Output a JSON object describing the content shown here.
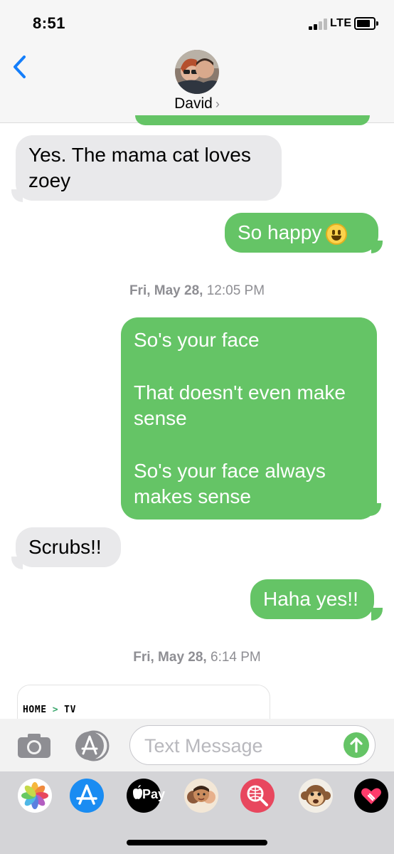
{
  "status_bar": {
    "time": "8:51",
    "network": "LTE"
  },
  "header": {
    "contact_name": "David",
    "chevron": "›"
  },
  "messages": [
    {
      "id": 1,
      "direction": "incoming",
      "text": "Yes. The mama cat loves zoey"
    },
    {
      "id": 2,
      "direction": "outgoing",
      "text": "So happy",
      "emoji": "grinning-face"
    },
    {
      "id": 3,
      "direction": "outgoing",
      "paragraphs": [
        "So's your face",
        "That doesn't even make sense",
        "So's your face always makes sense"
      ]
    },
    {
      "id": 4,
      "direction": "incoming",
      "text": "Scrubs!!"
    },
    {
      "id": 5,
      "direction": "outgoing",
      "text": "Haha yes!!"
    }
  ],
  "timestamps": [
    {
      "day": "Fri, May 28,",
      "time": " 12:05 PM"
    },
    {
      "day": "Fri, May 28,",
      "time": " 6:14 PM"
    }
  ],
  "link_preview": {
    "crumb_home": "HOME",
    "crumb_sep": ">",
    "crumb_section": "TV"
  },
  "composer": {
    "placeholder": "Text Message",
    "value": ""
  },
  "app_drawer": [
    {
      "name": "photos-app-icon"
    },
    {
      "name": "app-store-icon"
    },
    {
      "name": "apple-pay-icon",
      "label": "Pay"
    },
    {
      "name": "memoji-stickers-icon"
    },
    {
      "name": "web-search-icon"
    },
    {
      "name": "animoji-monkey-icon"
    },
    {
      "name": "digital-touch-icon"
    }
  ],
  "colors": {
    "imessage_green": "#65c466",
    "incoming_gray": "#e9e9eb",
    "ios_blue": "#147efb",
    "timestamp_gray": "#8e8e93"
  }
}
